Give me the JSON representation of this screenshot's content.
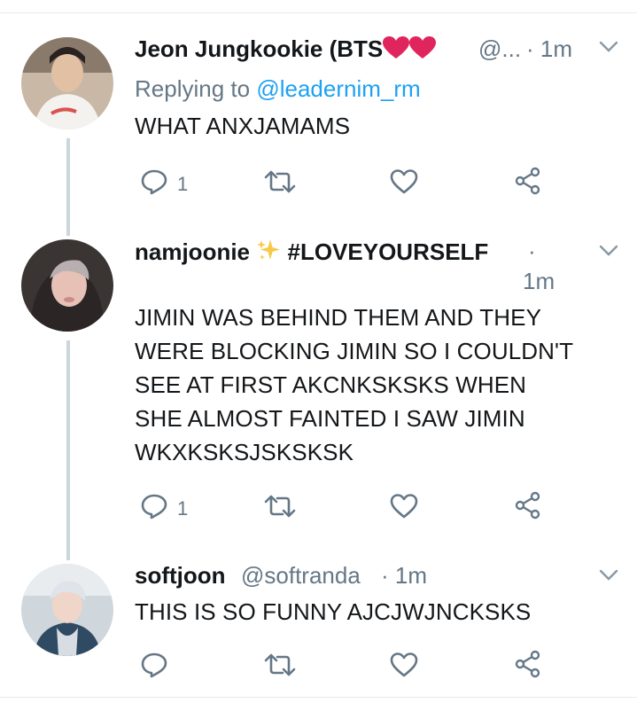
{
  "tweets": [
    {
      "name": "Jeon Jungkookie (BTS",
      "handle": "@...",
      "time": "· 1m",
      "replying_prefix": "Replying to ",
      "replying_handle": "@leadernim_rm",
      "text_lines": [
        "WHAT ANXJAMAMS"
      ],
      "reply_count": "1",
      "retweet_count": "",
      "like_count": ""
    },
    {
      "name": "namjoonie",
      "hashtag": "#LOVEYOURSELF",
      "dot": "·",
      "time": "1m",
      "text_lines": [
        "JIMIN WAS BEHIND THEM AND THEY",
        "WERE BLOCKING JIMIN SO I COULDN'T",
        "SEE AT FIRST AKCNKSKSKS WHEN",
        "SHE ALMOST FAINTED I SAW JIMIN",
        "WKXKSKSJSKSKSK"
      ],
      "reply_count": "1",
      "retweet_count": "",
      "like_count": ""
    },
    {
      "name": "softjoon",
      "handle": "@softranda",
      "time": "· 1m",
      "text_lines": [
        "THIS IS SO FUNNY AJCJWJNCKSKS"
      ],
      "reply_count": "",
      "retweet_count": "",
      "like_count": ""
    }
  ],
  "icons": {
    "reply": "reply-icon",
    "retweet": "retweet-icon",
    "like": "heart-icon",
    "share": "share-icon",
    "menu": "chevron-down-icon",
    "heart_emoji": "red-heart-emoji",
    "sparkles_emoji": "sparkles-emoji"
  },
  "colors": {
    "link_blue": "#1da1f2",
    "muted_gray": "#657786",
    "icon_gray": "#657786",
    "thread_line": "#ccd6dd",
    "heart_red": "#e0245e",
    "sparkle_yellow": "#f7c948"
  }
}
